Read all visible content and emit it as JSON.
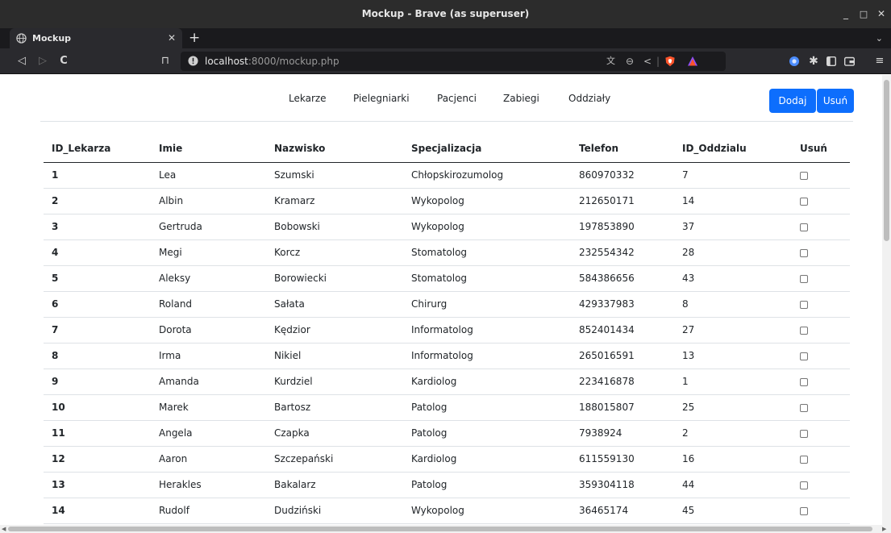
{
  "window": {
    "title": "Mockup - Brave (as superuser)"
  },
  "window_controls": {
    "minimize": "_",
    "maximize": "□",
    "close": "✕"
  },
  "tab": {
    "title": "Mockup",
    "close": "✕",
    "new": "+",
    "list": "⌄"
  },
  "toolbar": {
    "back": "◁",
    "forward": "▷",
    "reload": "C",
    "bookmark": "⊓",
    "url_host": "localhost",
    "url_path": ":8000/mockup.php"
  },
  "nav": {
    "links": [
      "Lekarze",
      "Pielegniarki",
      "Pacjenci",
      "Zabiegi",
      "Oddziały"
    ],
    "add_label": "Dodaj",
    "remove_label": "Usuń"
  },
  "table": {
    "headers": [
      "ID_Lekarza",
      "Imie",
      "Nazwisko",
      "Specjalizacja",
      "Telefon",
      "ID_Oddzialu",
      "Usuń"
    ],
    "rows": [
      [
        "1",
        "Lea",
        "Szumski",
        "Chłopskirozumolog",
        "860970332",
        "7"
      ],
      [
        "2",
        "Albin",
        "Kramarz",
        "Wykopolog",
        "212650171",
        "14"
      ],
      [
        "3",
        "Gertruda",
        "Bobowski",
        "Wykopolog",
        "197853890",
        "37"
      ],
      [
        "4",
        "Megi",
        "Korcz",
        "Stomatolog",
        "232554342",
        "28"
      ],
      [
        "5",
        "Aleksy",
        "Borowiecki",
        "Stomatolog",
        "584386656",
        "43"
      ],
      [
        "6",
        "Roland",
        "Sałata",
        "Chirurg",
        "429337983",
        "8"
      ],
      [
        "7",
        "Dorota",
        "Kędzior",
        "Informatolog",
        "852401434",
        "27"
      ],
      [
        "8",
        "Irma",
        "Nikiel",
        "Informatolog",
        "265016591",
        "13"
      ],
      [
        "9",
        "Amanda",
        "Kurdziel",
        "Kardiolog",
        "223416878",
        "1"
      ],
      [
        "10",
        "Marek",
        "Bartosz",
        "Patolog",
        "188015807",
        "25"
      ],
      [
        "11",
        "Angela",
        "Czapka",
        "Patolog",
        "7938924",
        "2"
      ],
      [
        "12",
        "Aaron",
        "Szczepański",
        "Kardiolog",
        "611559130",
        "16"
      ],
      [
        "13",
        "Herakles",
        "Bakalarz",
        "Patolog",
        "359304118",
        "44"
      ],
      [
        "14",
        "Rudolf",
        "Dudziński",
        "Wykopolog",
        "36465174",
        "45"
      ]
    ]
  },
  "colors": {
    "primary": "#0d6efd",
    "brave": "#fb542b"
  }
}
